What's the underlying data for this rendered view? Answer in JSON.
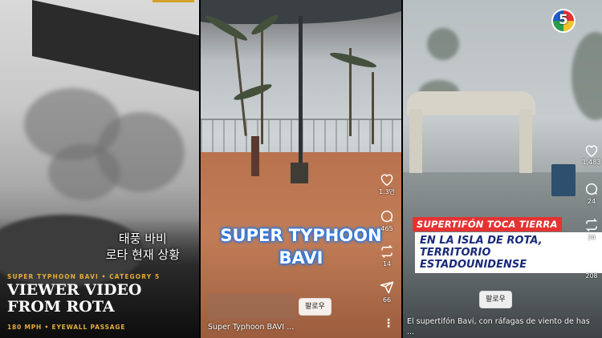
{
  "panel1": {
    "korean_lines": [
      "태풍 바비",
      "로타 현재 상황"
    ],
    "category": "SUPER TYPHOON BAVI • CATEGORY 5",
    "title": "VIEWER VIDEO FROM ROTA",
    "subtitle": "180 MPH • EYEWALL PASSAGE"
  },
  "panel2": {
    "overlay_lines": [
      "SUPER TYPHOON",
      "BAVI"
    ],
    "likes": "1.3만",
    "comments": "465",
    "reposts": "14",
    "shares": "66",
    "follow_label": "팔로우",
    "caption": "Super Typhoon BAVI ...",
    "more": "⋮"
  },
  "panel3": {
    "logo_text": "5",
    "headline": "SUPERTIFÓN TOCA TIERRA",
    "subheadline_lines": [
      "EN LA ISLA DE ROTA,",
      "TERRITORIO ESTADOUNIDENSE"
    ],
    "likes": "1,483",
    "comments": "24",
    "reposts": "34",
    "shares": "208",
    "follow_label": "팔로우",
    "caption": "El supertifón Bavi, con ráfagas de viento de has",
    "caption_more": "...",
    "icon_color": "#ffffff"
  }
}
